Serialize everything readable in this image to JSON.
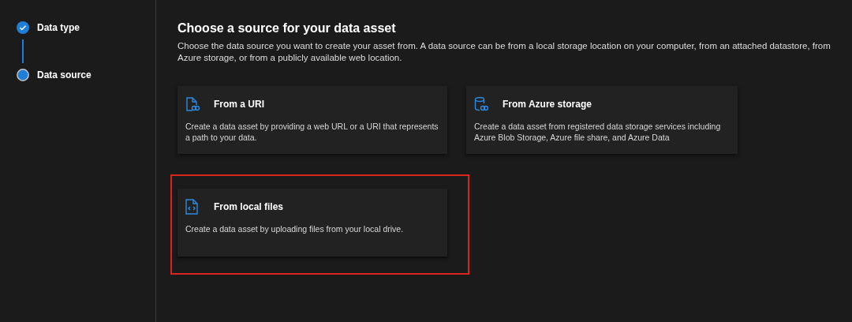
{
  "steps": [
    {
      "label": "Data type",
      "completed": true
    },
    {
      "label": "Data source",
      "completed": false
    }
  ],
  "heading": "Choose a source for your data asset",
  "description": "Choose the data source you want to create your asset from. A data source can be from a local storage location on your computer, from an attached datastore, from Azure storage, or from a publicly available web location.",
  "sources": [
    {
      "kind": "uri",
      "title": "From a URI",
      "description": "Create a data asset by providing a web URL or a URI that represents a path to your data.",
      "highlighted": false
    },
    {
      "kind": "azure",
      "title": "From Azure storage",
      "description": "Create a data asset from registered data storage services including Azure Blob Storage, Azure file share, and Azure Data",
      "highlighted": false
    },
    {
      "kind": "local",
      "title": "From local files",
      "description": "Create a data asset by uploading files from your local drive.",
      "highlighted": true
    }
  ]
}
